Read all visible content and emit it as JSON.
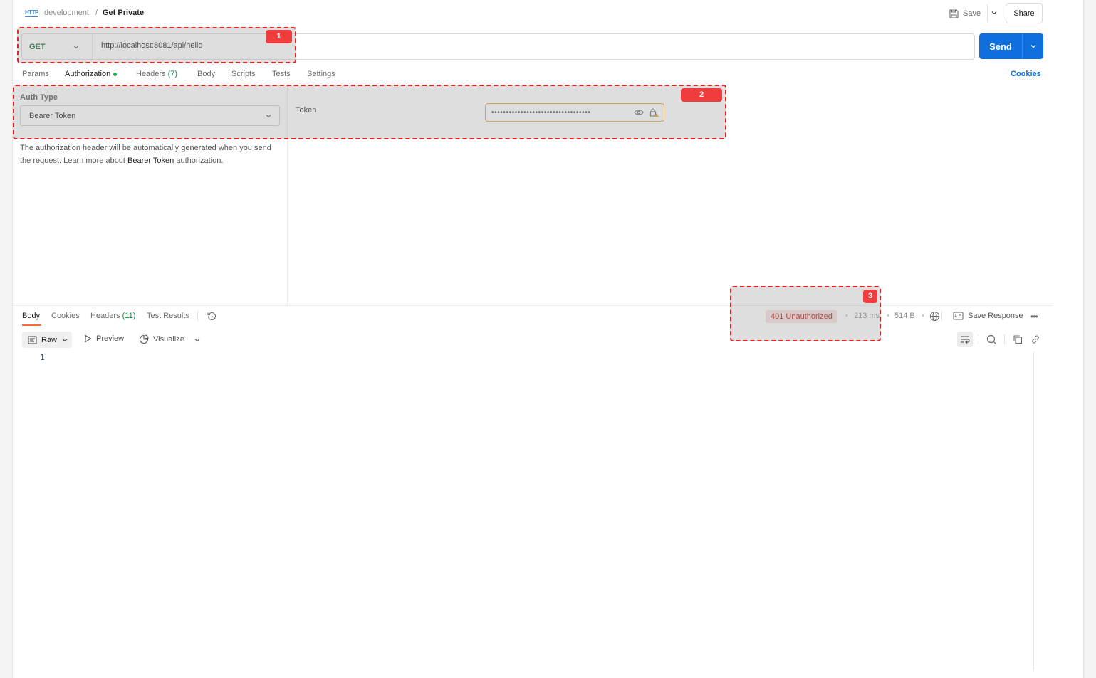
{
  "header": {
    "badge": "HTTP",
    "workspace": "development",
    "separator": "/",
    "request_name": "Get Private",
    "save_label": "Save",
    "share_label": "Share"
  },
  "request": {
    "method": "GET",
    "url": "http://localhost:8081/api/hello",
    "send_label": "Send"
  },
  "request_tabs": [
    {
      "label": "Params"
    },
    {
      "label": "Authorization"
    },
    {
      "label": "Headers",
      "count": "(7)"
    },
    {
      "label": "Body"
    },
    {
      "label": "Scripts"
    },
    {
      "label": "Tests"
    },
    {
      "label": "Settings"
    }
  ],
  "cookies_label": "Cookies",
  "auth": {
    "type_label": "Auth Type",
    "type_value": "Bearer Token",
    "desc_part1": "The authorization header will be automatically generated when you send the request. Learn more about ",
    "desc_link": "Bearer Token",
    "desc_part2": " authorization.",
    "token_label": "Token",
    "token_value": "••••••••••••••••••••••••••••••••••"
  },
  "response": {
    "tabs": [
      {
        "label": "Body"
      },
      {
        "label": "Cookies"
      },
      {
        "label": "Headers",
        "count": "(11)"
      },
      {
        "label": "Test Results"
      }
    ],
    "status": "401 Unauthorized",
    "time": "213 ms",
    "size": "514 B",
    "save_response": "Save Response",
    "format": "Raw",
    "preview_label": "Preview",
    "visualize_label": "Visualize",
    "line_number": "1"
  },
  "annotations": [
    "1",
    "2",
    "3"
  ],
  "colors": {
    "send": "#0f6fdc",
    "method": "#0b6b34",
    "error_text": "#b3261e",
    "error_bg": "#f8dfdf",
    "annotation": "#e02424",
    "active_tab": "#ff6c37"
  },
  "icons": {
    "rail": [
      "document-icon",
      "comment-icon",
      "code-icon",
      "sync-icon",
      "info-icon"
    ]
  }
}
